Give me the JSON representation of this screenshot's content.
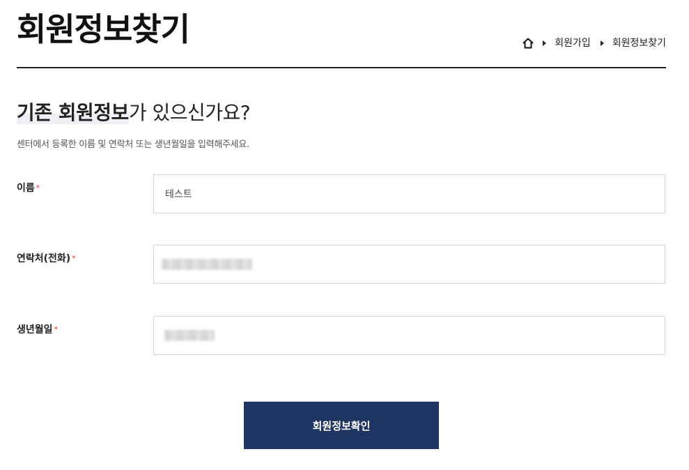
{
  "header": {
    "title": "회원정보찾기",
    "breadcrumb": {
      "home_icon": "home-icon",
      "items": [
        "회원가입",
        "회원정보찾기"
      ]
    }
  },
  "section": {
    "heading_strong": "기존 회원정보",
    "heading_rest": "가 있으신가요?",
    "description": "센터에서 등록한 이름 및 연락처 또는 생년월일을 입력해주세요."
  },
  "form": {
    "required_mark": "*",
    "fields": [
      {
        "label": "이름",
        "value": "테스트"
      },
      {
        "label": "연락처(전화)",
        "value": ""
      },
      {
        "label": "생년월일",
        "value": ""
      }
    ]
  },
  "submit": {
    "label": "회원정보확인"
  },
  "colors": {
    "primary": "#1e3461",
    "required": "#e03030",
    "border": "#d6d6d6"
  }
}
